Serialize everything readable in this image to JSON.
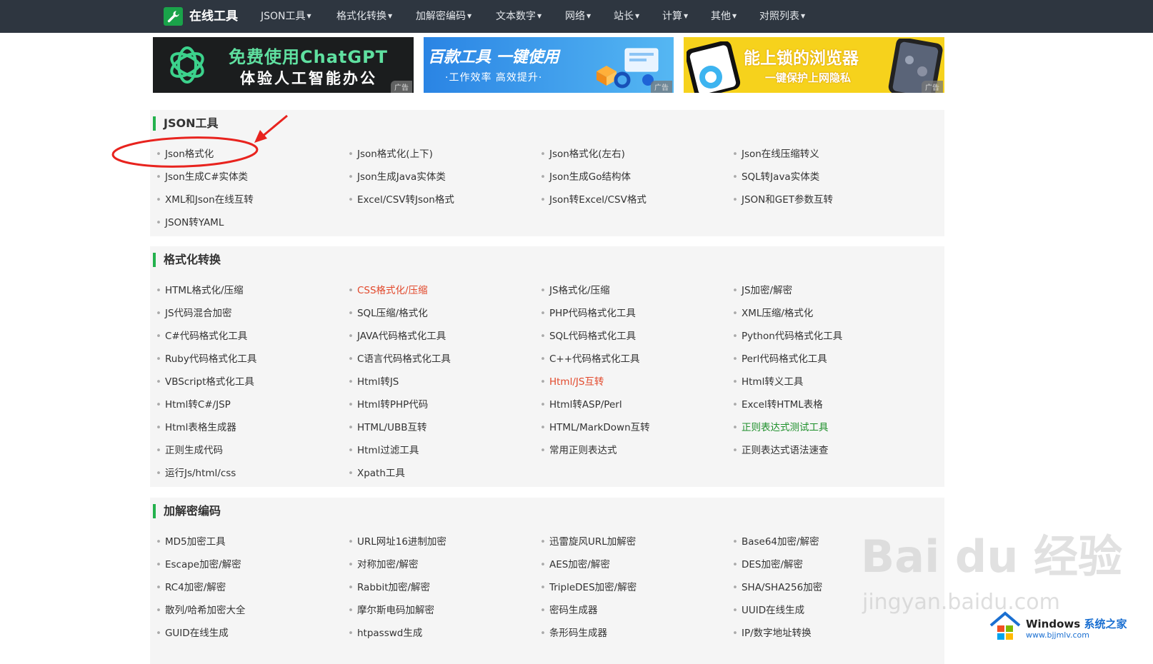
{
  "nav": {
    "site_name": "在线工具",
    "items": [
      "JSON工具",
      "格式化转换",
      "加解密编码",
      "文本数字",
      "网络",
      "站长",
      "计算",
      "其他",
      "对照列表"
    ]
  },
  "ads": [
    {
      "line1": "免费使用ChatGPT",
      "line2": "体验人工智能办公",
      "tag": "广告"
    },
    {
      "line1": "百款工具 一键使用",
      "line2": "·工作效率 高效提升·",
      "tag": "广告"
    },
    {
      "line1": "能上锁的浏览器",
      "line2": "一键保护上网隐私",
      "tag": "广告"
    }
  ],
  "sections": [
    {
      "title": "JSON工具",
      "links": [
        "Json格式化",
        "Json格式化(上下)",
        "Json格式化(左右)",
        "Json在线压缩转义",
        "Json生成C#实体类",
        "Json生成Java实体类",
        "Json生成Go结构体",
        "SQL转Java实体类",
        "XML和Json在线互转",
        "Excel/CSV转Json格式",
        "Json转Excel/CSV格式",
        "JSON和GET参数互转",
        "JSON转YAML"
      ]
    },
    {
      "title": "格式化转换",
      "links": [
        "HTML格式化/压缩",
        "CSS格式化/压缩",
        "JS格式化/压缩",
        "JS加密/解密",
        "JS代码混合加密",
        "SQL压缩/格式化",
        "PHP代码格式化工具",
        "XML压缩/格式化",
        "C#代码格式化工具",
        "JAVA代码格式化工具",
        "SQL代码格式化工具",
        "Python代码格式化工具",
        "Ruby代码格式化工具",
        "C语言代码格式化工具",
        "C++代码格式化工具",
        "Perl代码格式化工具",
        "VBScript格式化工具",
        "Html转JS",
        "Html/JS互转",
        "Html转义工具",
        "Html转C#/JSP",
        "Html转PHP代码",
        "Html转ASP/Perl",
        "Excel转HTML表格",
        "Html表格生成器",
        "HTML/UBB互转",
        "HTML/MarkDown互转",
        "正则表达式测试工具",
        "正则生成代码",
        "Html过滤工具",
        "常用正则表达式",
        "正则表达式语法速查",
        "运行Js/html/css",
        "Xpath工具"
      ]
    },
    {
      "title": "加解密编码",
      "links": [
        "MD5加密工具",
        "URL网址16进制加密",
        "迅雷旋风URL加解密",
        "Base64加密/解密",
        "Escape加密/解密",
        "对称加密/解密",
        "AES加密/解密",
        "DES加密/解密",
        "RC4加密/解密",
        "Rabbit加密/解密",
        "TripleDES加密/解密",
        "SHA/SHA256加密",
        "散列/哈希加密大全",
        "摩尔斯电码加解密",
        "密码生成器",
        "UUID在线生成",
        "GUID在线生成",
        "htpasswd生成",
        "条形码生成器",
        "IP/数字地址转换"
      ]
    }
  ],
  "colors": {
    "nav_bg": "#2e3640",
    "accent_green": "#23b14d",
    "link_red": "#e2492c",
    "link_green": "#1d8f2a",
    "annotation_red": "#e8231e"
  },
  "watermark": {
    "baidu": "Bai du 经验",
    "url": "jingyan.baidu.com",
    "windows": "Windows",
    "windows_cn": "系统之家",
    "windows_url": "www.bjjmlv.com"
  }
}
